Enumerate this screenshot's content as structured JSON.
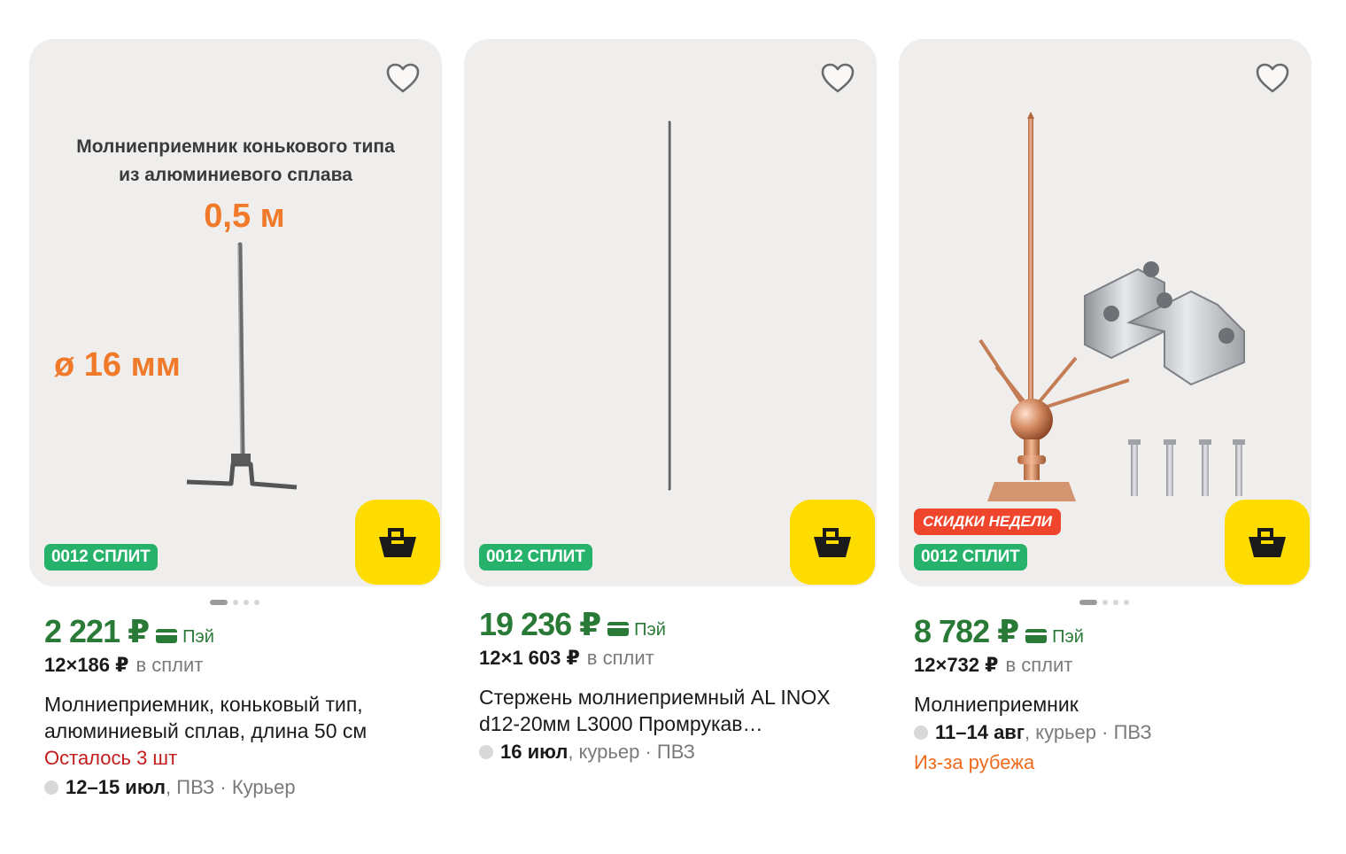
{
  "products": [
    {
      "image_text": {
        "line1": "Молниеприемник конькового типа",
        "line2": "из алюминиевого сплава",
        "length": "0,5 м",
        "diameter": "ø 16 мм"
      },
      "split_badge": "0012 СПЛИТ",
      "price": "2 221 ₽",
      "pay_label": "Пэй",
      "split_amount": "12×186 ₽",
      "split_label": "в сплит",
      "title_line1": "Молниеприемник, коньковый тип,",
      "title_line2": "алюминиевый сплав, длина 50 см",
      "stock": "Осталось 3 шт",
      "delivery_date": "12–15 июл",
      "delivery_methods": ", ПВЗ · Курьер",
      "favorite_icon": "heart-outline-icon",
      "cart_icon": "basket-icon"
    },
    {
      "split_badge": "0012 СПЛИТ",
      "price": "19 236 ₽",
      "pay_label": "Пэй",
      "split_amount": "12×1 603 ₽",
      "split_label": "в сплит",
      "title_line1": "Стержень молниеприемный AL INOX",
      "title_line2": "d12-20мм L3000 Промрукав…",
      "delivery_date": "16 июл",
      "delivery_methods": ", курьер · ПВЗ",
      "favorite_icon": "heart-outline-icon",
      "cart_icon": "basket-icon"
    },
    {
      "sale_badge": "СКИДКИ НЕДЕЛИ",
      "split_badge": "0012 СПЛИТ",
      "price": "8 782 ₽",
      "pay_label": "Пэй",
      "split_amount": "12×732 ₽",
      "split_label": "в сплит",
      "title_line1": "Молниеприемник",
      "delivery_date": "11–14 авг",
      "delivery_methods": ", курьер · ПВЗ",
      "origin": "Из-за рубежа",
      "favorite_icon": "heart-outline-icon",
      "cart_icon": "basket-icon"
    }
  ],
  "colors": {
    "price_green": "#2a7a37",
    "split_badge": "#26b26a",
    "cart_yellow": "#ffdc00",
    "sale_red": "#f0452d",
    "stock_red": "#c21c1c",
    "origin_orange": "#f06a1e",
    "media_bg": "#efeeec"
  }
}
